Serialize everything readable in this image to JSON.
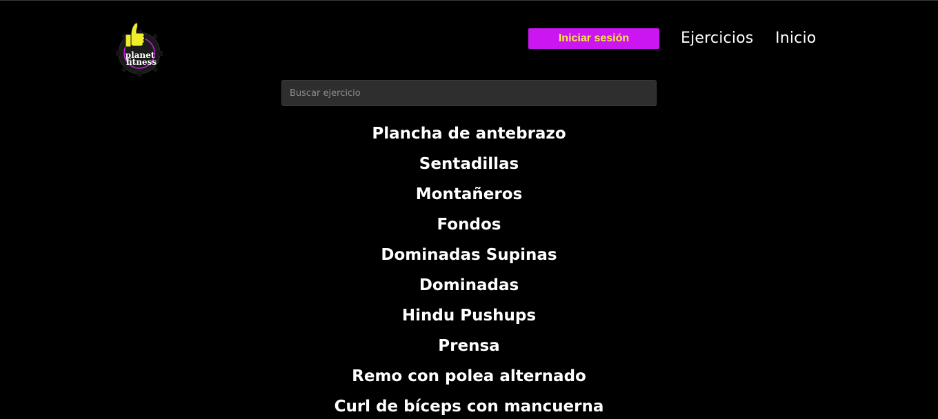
{
  "logo": {
    "line1": "planet",
    "line2": "fitness",
    "icon": "thumbs-up-gear-icon"
  },
  "header": {
    "login_label": "Iniciar sesión",
    "nav": [
      {
        "label": "Ejercicios"
      },
      {
        "label": "Inicio"
      }
    ]
  },
  "search": {
    "placeholder": "Buscar ejercicio",
    "value": ""
  },
  "exercises": [
    {
      "name": "Plancha de antebrazo"
    },
    {
      "name": "Sentadillas"
    },
    {
      "name": "Montañeros"
    },
    {
      "name": "Fondos"
    },
    {
      "name": "Dominadas Supinas"
    },
    {
      "name": "Dominadas"
    },
    {
      "name": "Hindu Pushups"
    },
    {
      "name": "Prensa"
    },
    {
      "name": "Remo con polea alternado"
    },
    {
      "name": "Curl de bíceps con mancuerna"
    }
  ],
  "colors": {
    "background": "#000000",
    "button_bg": "#cc16f2",
    "button_text": "#f6ee3a",
    "search_bg": "#2e2e2e",
    "text": "#ffffff"
  }
}
